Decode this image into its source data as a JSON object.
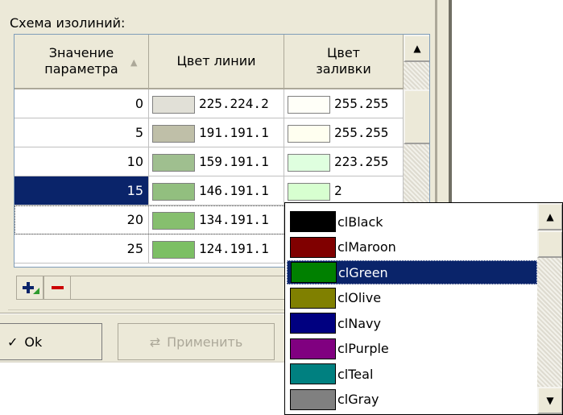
{
  "section_title": "Схема изолиний:",
  "grid": {
    "headers": {
      "value_line1": "Значение",
      "value_line2": "параметра",
      "line_color": "Цвет линии",
      "fill_line1": "Цвет",
      "fill_line2": "заливки"
    },
    "rows": [
      {
        "value": "0",
        "line_rgb": "225.224.2",
        "fill_rgb": "255.255",
        "line_hex": "#e1e0d7",
        "fill_hex": "#fffff8"
      },
      {
        "value": "5",
        "line_rgb": "191.191.1",
        "fill_rgb": "255.255",
        "line_hex": "#bfbfa8",
        "fill_hex": "#fffff0"
      },
      {
        "value": "10",
        "line_rgb": "159.191.1",
        "fill_rgb": "223.255",
        "line_hex": "#9fbf8f",
        "fill_hex": "#dfffdf"
      },
      {
        "value": "15",
        "line_rgb": "146.191.1",
        "fill_rgb": "2",
        "line_hex": "#92bf7f",
        "fill_hex": "#d7ffd0"
      },
      {
        "value": "20",
        "line_rgb": "134.191.1",
        "fill_rgb": "",
        "line_hex": "#86bf6e",
        "fill_hex": "#ffffff"
      },
      {
        "value": "25",
        "line_rgb": "124.191.1",
        "fill_rgb": "",
        "line_hex": "#7cbf64",
        "fill_hex": "#ffffff"
      }
    ],
    "selected_value": "15"
  },
  "buttons": {
    "ok": "Ok",
    "apply": "Применить"
  },
  "dropdown": {
    "items": [
      {
        "name": "clBlack",
        "color": "#000000"
      },
      {
        "name": "clMaroon",
        "color": "#800000"
      },
      {
        "name": "clGreen",
        "color": "#008000"
      },
      {
        "name": "clOlive",
        "color": "#808000"
      },
      {
        "name": "clNavy",
        "color": "#000080"
      },
      {
        "name": "clPurple",
        "color": "#800080"
      },
      {
        "name": "clTeal",
        "color": "#008080"
      },
      {
        "name": "clGray",
        "color": "#808080"
      }
    ],
    "selected": "clGreen"
  },
  "colors": {
    "selection": "#0a246a",
    "panel": "#ece9d8"
  }
}
